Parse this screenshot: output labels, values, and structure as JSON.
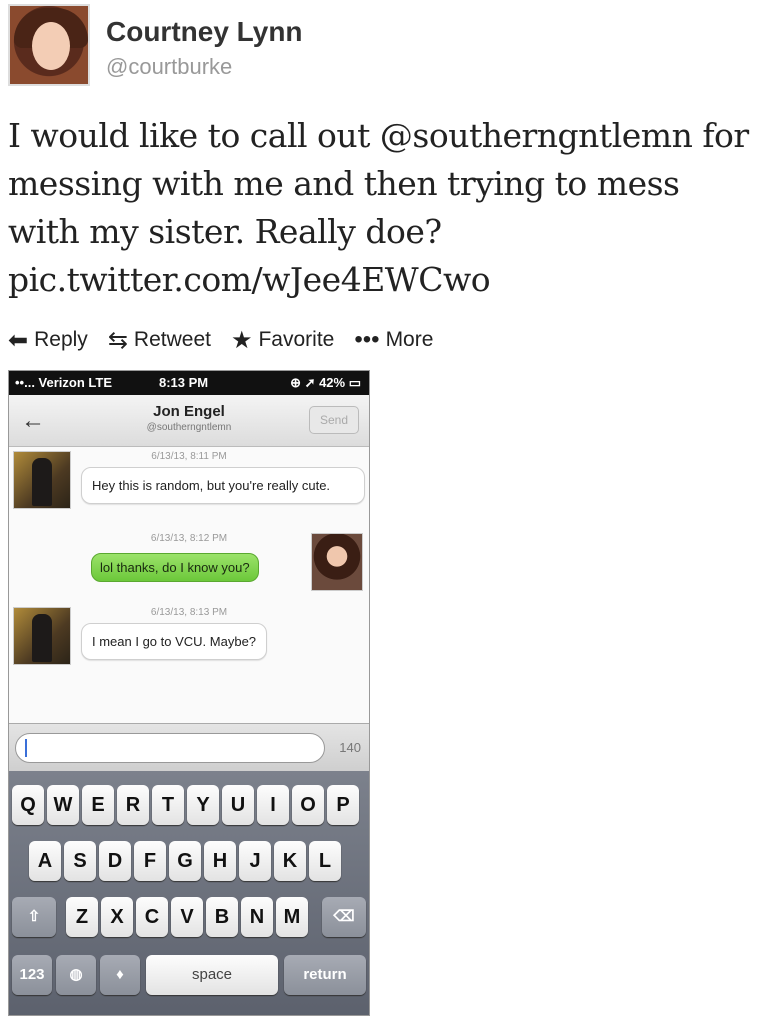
{
  "tweet": {
    "user_name": "Courtney Lynn",
    "user_handle": "@courtburke",
    "text": "I would like to call out @southerngntlemn for messing with me and then trying to mess with my sister. Really doe? pic.twitter.com/wJee4EWCwo",
    "actions": {
      "reply": "Reply",
      "retweet": "Retweet",
      "favorite": "Favorite",
      "more": "More"
    }
  },
  "phone": {
    "status": {
      "carrier": "••... Verizon  LTE",
      "time": "8:13 PM",
      "battery": "⊕ ➚ 42% ▭"
    },
    "nav": {
      "title": "Jon Engel",
      "subtitle": "@southerngntlemn",
      "send": "Send"
    },
    "messages": [
      {
        "timestamp": "6/13/13, 8:11 PM",
        "text": "Hey this is random, but you're really cute.",
        "direction": "incoming"
      },
      {
        "timestamp": "6/13/13, 8:12 PM",
        "text": "lol thanks, do I know you?",
        "direction": "outgoing"
      },
      {
        "timestamp": "6/13/13, 8:13 PM",
        "text": "I mean I go to VCU. Maybe?",
        "direction": "incoming"
      }
    ],
    "input": {
      "char_count": "140"
    },
    "keyboard": {
      "row1": [
        "Q",
        "W",
        "E",
        "R",
        "T",
        "Y",
        "U",
        "I",
        "O",
        "P"
      ],
      "row2": [
        "A",
        "S",
        "D",
        "F",
        "G",
        "H",
        "J",
        "K",
        "L"
      ],
      "row3": [
        "Z",
        "X",
        "C",
        "V",
        "B",
        "N",
        "M"
      ],
      "bottom": {
        "numbers": "123",
        "space": "space",
        "return": "return"
      }
    }
  }
}
